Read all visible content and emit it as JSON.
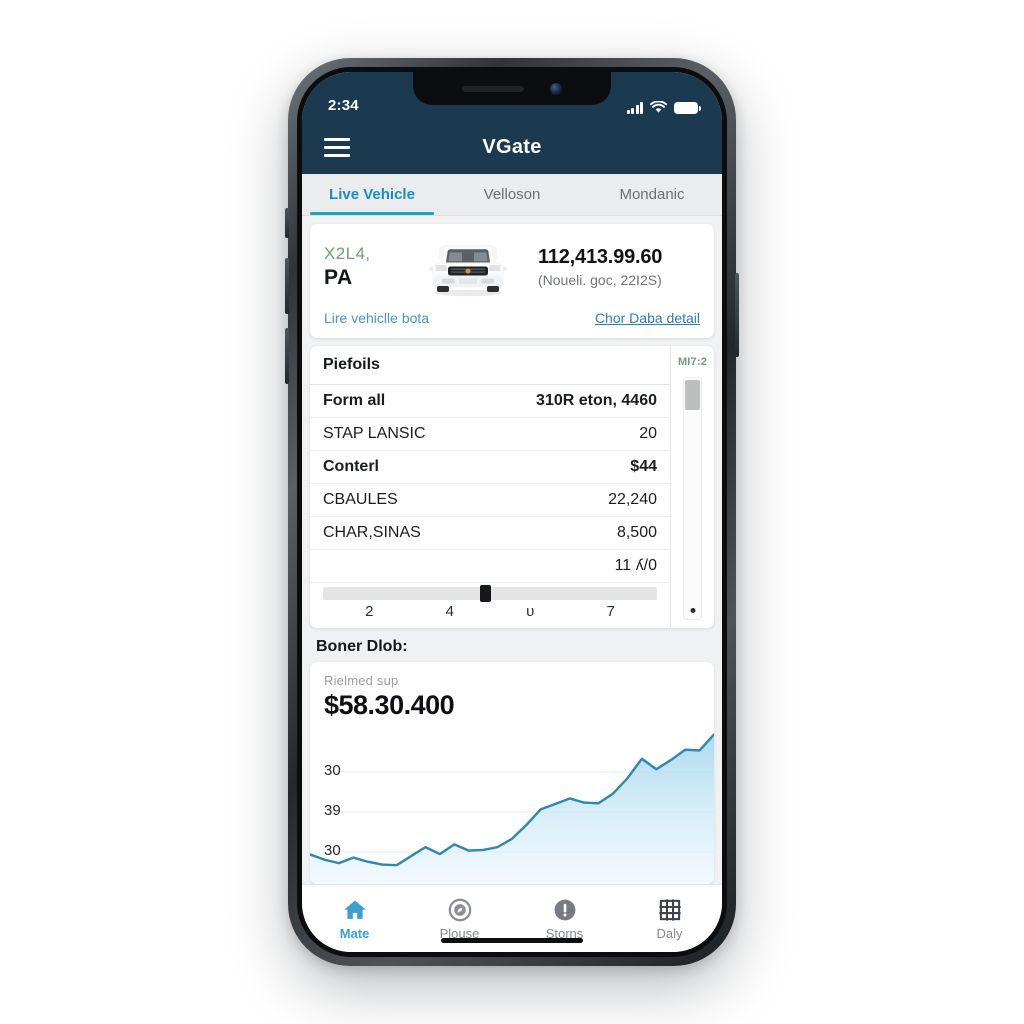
{
  "status_bar": {
    "time": "2:34",
    "signal_icon": "cellular-signal-icon",
    "wifi_icon": "wifi-icon",
    "battery_icon": "battery-icon"
  },
  "app_bar": {
    "menu_icon": "hamburger-menu-icon",
    "title": "VGate"
  },
  "tabs": [
    {
      "label": "Live Vehicle",
      "active": true
    },
    {
      "label": "Velloson",
      "active": false
    },
    {
      "label": "Mondanic",
      "active": false
    }
  ],
  "vehicle_card": {
    "code_top": "X2L4,",
    "code_bottom": "PA",
    "image_name": "white-suv-front-view",
    "primary_value": "112,413.99.60",
    "secondary_value": "(Noueli. goc, 22I2S)",
    "link_left": "Lire vehiclle bota",
    "link_right": "Chor Daba detail"
  },
  "details": {
    "title": "Piefoils",
    "badge": "MI7:2",
    "rows": [
      {
        "label": "Form all",
        "value": "310R eton, 4460",
        "strong": true
      },
      {
        "label": "STAP LANSIC",
        "value": "20",
        "strong": false
      },
      {
        "label": "Conterl",
        "value": "$44",
        "strong": true
      },
      {
        "label": "CBAULES",
        "value": "22,240",
        "strong": false
      },
      {
        "label": "CHAR,SINAS",
        "value": "8,500",
        "strong": false
      },
      {
        "label": "",
        "value": "11 ʎ/0",
        "strong": false
      }
    ],
    "scroll_ticks": [
      "2",
      "4",
      "ᴜ",
      "7"
    ]
  },
  "chart_section": {
    "heading": "Boner Dlob:",
    "caption": "Rielmed sup",
    "amount": "$58.30.400"
  },
  "chart_data": {
    "type": "area",
    "title": "Boner Dlob:",
    "subtitle": "Rielmed sup",
    "value_label": "$58.30.400",
    "xlabel": "",
    "ylabel": "",
    "ytick_labels": [
      "30",
      "39",
      "30"
    ],
    "ytick_values": [
      30,
      39,
      30
    ],
    "ylim": [
      0,
      46
    ],
    "grid": true,
    "legend": "none",
    "line_color": "#2e87ae",
    "fill_top_color": "#a8d8ef",
    "fill_bottom_color": "#e8f5fc",
    "x": [
      0,
      1,
      2,
      3,
      4,
      5,
      6,
      7,
      8,
      9,
      10,
      11,
      12,
      13,
      14,
      15,
      16,
      17,
      18,
      19,
      20,
      21,
      22,
      23,
      24,
      25,
      26,
      27,
      28
    ],
    "values": [
      8.5,
      7.0,
      6.0,
      7.6,
      6.4,
      5.6,
      5.4,
      8.0,
      10.6,
      8.6,
      11.4,
      9.6,
      9.8,
      10.6,
      13.0,
      17.0,
      21.5,
      23.0,
      24.6,
      23.4,
      23.2,
      26.0,
      30.4,
      36.0,
      33.0,
      35.6,
      38.6,
      38.4,
      43.0
    ]
  },
  "bottom_nav": [
    {
      "label": "Mate",
      "icon": "home-icon",
      "active": true
    },
    {
      "label": "Plouse",
      "icon": "compass-icon",
      "active": false
    },
    {
      "label": "Storns",
      "icon": "alert-circle-icon",
      "active": false
    },
    {
      "label": "Daly",
      "icon": "grid-icon",
      "active": false
    }
  ],
  "colors": {
    "app_bar": "#1b3a50",
    "accent_blue": "#1c8bc4",
    "tab_underline": "#17a8b8",
    "chart_line": "#2e87ae",
    "green_text": "#6f9f77"
  }
}
